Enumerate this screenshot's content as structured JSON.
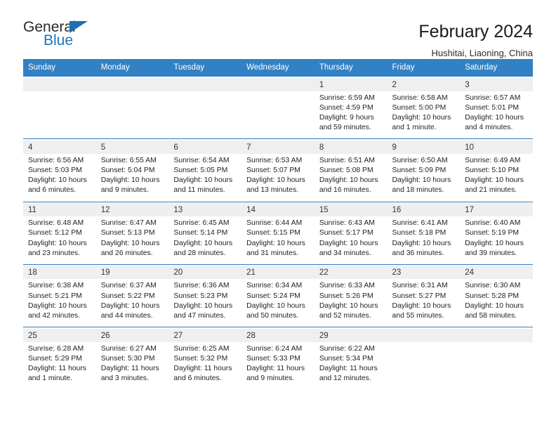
{
  "brand": {
    "name_part1": "General",
    "name_part2": "Blue",
    "accent_color": "#1c74bc",
    "triangle_icon": "logo-triangle-icon"
  },
  "header": {
    "title": "February 2024",
    "subtitle": "Hushitai, Liaoning, China"
  },
  "theme": {
    "header_row_bg": "#3281c4",
    "daynum_bg": "#efefef",
    "separator": "#2f7cbf"
  },
  "weekday_headers": [
    "Sunday",
    "Monday",
    "Tuesday",
    "Wednesday",
    "Thursday",
    "Friday",
    "Saturday"
  ],
  "weeks": [
    {
      "days": [
        {
          "num": "",
          "sunrise": "",
          "sunset": "",
          "daylight1": "",
          "daylight2": ""
        },
        {
          "num": "",
          "sunrise": "",
          "sunset": "",
          "daylight1": "",
          "daylight2": ""
        },
        {
          "num": "",
          "sunrise": "",
          "sunset": "",
          "daylight1": "",
          "daylight2": ""
        },
        {
          "num": "",
          "sunrise": "",
          "sunset": "",
          "daylight1": "",
          "daylight2": ""
        },
        {
          "num": "1",
          "sunrise": "Sunrise: 6:59 AM",
          "sunset": "Sunset: 4:59 PM",
          "daylight1": "Daylight: 9 hours",
          "daylight2": "and 59 minutes."
        },
        {
          "num": "2",
          "sunrise": "Sunrise: 6:58 AM",
          "sunset": "Sunset: 5:00 PM",
          "daylight1": "Daylight: 10 hours",
          "daylight2": "and 1 minute."
        },
        {
          "num": "3",
          "sunrise": "Sunrise: 6:57 AM",
          "sunset": "Sunset: 5:01 PM",
          "daylight1": "Daylight: 10 hours",
          "daylight2": "and 4 minutes."
        }
      ]
    },
    {
      "days": [
        {
          "num": "4",
          "sunrise": "Sunrise: 6:56 AM",
          "sunset": "Sunset: 5:03 PM",
          "daylight1": "Daylight: 10 hours",
          "daylight2": "and 6 minutes."
        },
        {
          "num": "5",
          "sunrise": "Sunrise: 6:55 AM",
          "sunset": "Sunset: 5:04 PM",
          "daylight1": "Daylight: 10 hours",
          "daylight2": "and 9 minutes."
        },
        {
          "num": "6",
          "sunrise": "Sunrise: 6:54 AM",
          "sunset": "Sunset: 5:05 PM",
          "daylight1": "Daylight: 10 hours",
          "daylight2": "and 11 minutes."
        },
        {
          "num": "7",
          "sunrise": "Sunrise: 6:53 AM",
          "sunset": "Sunset: 5:07 PM",
          "daylight1": "Daylight: 10 hours",
          "daylight2": "and 13 minutes."
        },
        {
          "num": "8",
          "sunrise": "Sunrise: 6:51 AM",
          "sunset": "Sunset: 5:08 PM",
          "daylight1": "Daylight: 10 hours",
          "daylight2": "and 16 minutes."
        },
        {
          "num": "9",
          "sunrise": "Sunrise: 6:50 AM",
          "sunset": "Sunset: 5:09 PM",
          "daylight1": "Daylight: 10 hours",
          "daylight2": "and 18 minutes."
        },
        {
          "num": "10",
          "sunrise": "Sunrise: 6:49 AM",
          "sunset": "Sunset: 5:10 PM",
          "daylight1": "Daylight: 10 hours",
          "daylight2": "and 21 minutes."
        }
      ]
    },
    {
      "days": [
        {
          "num": "11",
          "sunrise": "Sunrise: 6:48 AM",
          "sunset": "Sunset: 5:12 PM",
          "daylight1": "Daylight: 10 hours",
          "daylight2": "and 23 minutes."
        },
        {
          "num": "12",
          "sunrise": "Sunrise: 6:47 AM",
          "sunset": "Sunset: 5:13 PM",
          "daylight1": "Daylight: 10 hours",
          "daylight2": "and 26 minutes."
        },
        {
          "num": "13",
          "sunrise": "Sunrise: 6:45 AM",
          "sunset": "Sunset: 5:14 PM",
          "daylight1": "Daylight: 10 hours",
          "daylight2": "and 28 minutes."
        },
        {
          "num": "14",
          "sunrise": "Sunrise: 6:44 AM",
          "sunset": "Sunset: 5:15 PM",
          "daylight1": "Daylight: 10 hours",
          "daylight2": "and 31 minutes."
        },
        {
          "num": "15",
          "sunrise": "Sunrise: 6:43 AM",
          "sunset": "Sunset: 5:17 PM",
          "daylight1": "Daylight: 10 hours",
          "daylight2": "and 34 minutes."
        },
        {
          "num": "16",
          "sunrise": "Sunrise: 6:41 AM",
          "sunset": "Sunset: 5:18 PM",
          "daylight1": "Daylight: 10 hours",
          "daylight2": "and 36 minutes."
        },
        {
          "num": "17",
          "sunrise": "Sunrise: 6:40 AM",
          "sunset": "Sunset: 5:19 PM",
          "daylight1": "Daylight: 10 hours",
          "daylight2": "and 39 minutes."
        }
      ]
    },
    {
      "days": [
        {
          "num": "18",
          "sunrise": "Sunrise: 6:38 AM",
          "sunset": "Sunset: 5:21 PM",
          "daylight1": "Daylight: 10 hours",
          "daylight2": "and 42 minutes."
        },
        {
          "num": "19",
          "sunrise": "Sunrise: 6:37 AM",
          "sunset": "Sunset: 5:22 PM",
          "daylight1": "Daylight: 10 hours",
          "daylight2": "and 44 minutes."
        },
        {
          "num": "20",
          "sunrise": "Sunrise: 6:36 AM",
          "sunset": "Sunset: 5:23 PM",
          "daylight1": "Daylight: 10 hours",
          "daylight2": "and 47 minutes."
        },
        {
          "num": "21",
          "sunrise": "Sunrise: 6:34 AM",
          "sunset": "Sunset: 5:24 PM",
          "daylight1": "Daylight: 10 hours",
          "daylight2": "and 50 minutes."
        },
        {
          "num": "22",
          "sunrise": "Sunrise: 6:33 AM",
          "sunset": "Sunset: 5:26 PM",
          "daylight1": "Daylight: 10 hours",
          "daylight2": "and 52 minutes."
        },
        {
          "num": "23",
          "sunrise": "Sunrise: 6:31 AM",
          "sunset": "Sunset: 5:27 PM",
          "daylight1": "Daylight: 10 hours",
          "daylight2": "and 55 minutes."
        },
        {
          "num": "24",
          "sunrise": "Sunrise: 6:30 AM",
          "sunset": "Sunset: 5:28 PM",
          "daylight1": "Daylight: 10 hours",
          "daylight2": "and 58 minutes."
        }
      ]
    },
    {
      "days": [
        {
          "num": "25",
          "sunrise": "Sunrise: 6:28 AM",
          "sunset": "Sunset: 5:29 PM",
          "daylight1": "Daylight: 11 hours",
          "daylight2": "and 1 minute."
        },
        {
          "num": "26",
          "sunrise": "Sunrise: 6:27 AM",
          "sunset": "Sunset: 5:30 PM",
          "daylight1": "Daylight: 11 hours",
          "daylight2": "and 3 minutes."
        },
        {
          "num": "27",
          "sunrise": "Sunrise: 6:25 AM",
          "sunset": "Sunset: 5:32 PM",
          "daylight1": "Daylight: 11 hours",
          "daylight2": "and 6 minutes."
        },
        {
          "num": "28",
          "sunrise": "Sunrise: 6:24 AM",
          "sunset": "Sunset: 5:33 PM",
          "daylight1": "Daylight: 11 hours",
          "daylight2": "and 9 minutes."
        },
        {
          "num": "29",
          "sunrise": "Sunrise: 6:22 AM",
          "sunset": "Sunset: 5:34 PM",
          "daylight1": "Daylight: 11 hours",
          "daylight2": "and 12 minutes."
        },
        {
          "num": "",
          "sunrise": "",
          "sunset": "",
          "daylight1": "",
          "daylight2": ""
        },
        {
          "num": "",
          "sunrise": "",
          "sunset": "",
          "daylight1": "",
          "daylight2": ""
        }
      ]
    }
  ]
}
